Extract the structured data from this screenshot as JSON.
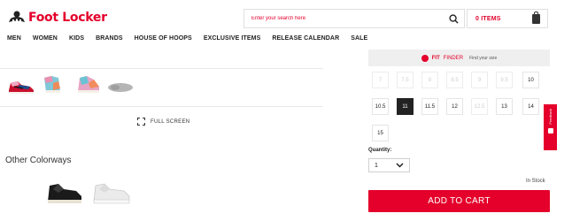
{
  "header": {
    "logo_text": "Foot Locker",
    "search_placeholder": "Enter your search here",
    "cart_items": "0 ITEMS"
  },
  "nav": [
    "MEN",
    "WOMEN",
    "KIDS",
    "BRANDS",
    "HOUSE OF HOOPS",
    "EXCLUSIVE ITEMS",
    "RELEASE CALENDAR",
    "SALE"
  ],
  "gallery": {
    "fullscreen_label": "FULL SCREEN",
    "thumbnails": [
      "shoe-side-thumbnail",
      "shoe-back-thumbnail",
      "shoe-angle-thumbnail",
      "shoe-sole-thumbnail"
    ]
  },
  "colorways": {
    "title": "Other Colorways",
    "items": [
      "black-colorway",
      "white-colorway"
    ]
  },
  "fit_finder": {
    "label_bold": "FIT",
    "label": "FINDER",
    "sub": "Find your size"
  },
  "sizes": [
    {
      "label": "7",
      "available": false,
      "selected": false
    },
    {
      "label": "7.5",
      "available": false,
      "selected": false
    },
    {
      "label": "8",
      "available": false,
      "selected": false
    },
    {
      "label": "8.5",
      "available": false,
      "selected": false
    },
    {
      "label": "9",
      "available": false,
      "selected": false
    },
    {
      "label": "9.5",
      "available": false,
      "selected": false
    },
    {
      "label": "10",
      "available": true,
      "selected": false
    },
    {
      "label": "10.5",
      "available": true,
      "selected": false
    },
    {
      "label": "11",
      "available": true,
      "selected": true
    },
    {
      "label": "11.5",
      "available": true,
      "selected": false
    },
    {
      "label": "12",
      "available": true,
      "selected": false
    },
    {
      "label": "12.5",
      "available": false,
      "selected": false
    },
    {
      "label": "13",
      "available": true,
      "selected": false
    },
    {
      "label": "14",
      "available": true,
      "selected": false
    },
    {
      "label": "15",
      "available": true,
      "selected": false
    }
  ],
  "feedback_label": "Feedback",
  "quantity": {
    "label": "Quantity:",
    "value": "1"
  },
  "stock_status": "In Stock",
  "add_to_cart_label": "ADD TO CART",
  "colors": {
    "brand_red": "#e4002b",
    "selected_size_bg": "#222222"
  }
}
